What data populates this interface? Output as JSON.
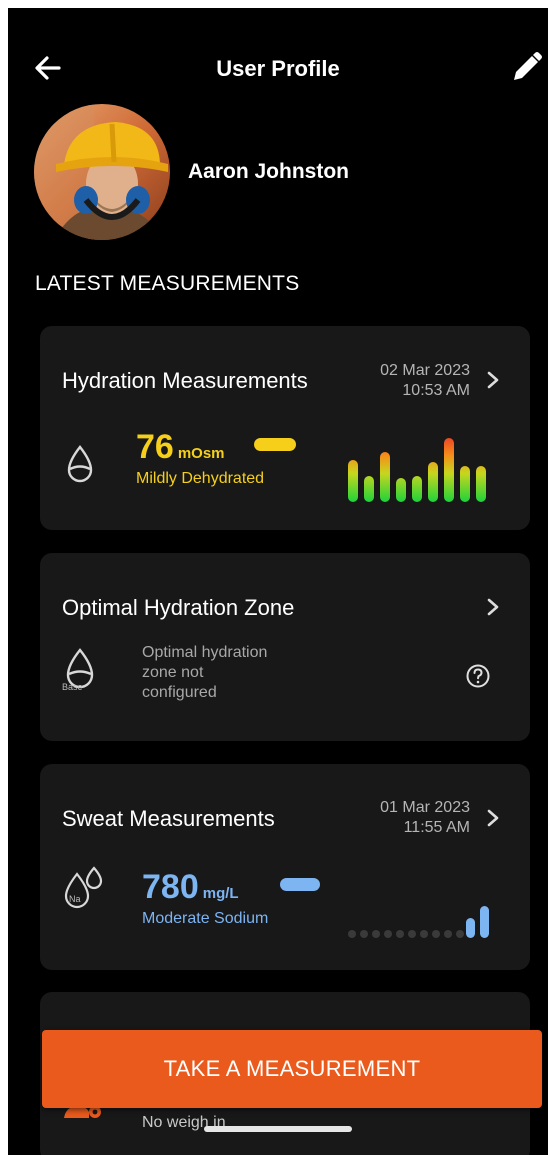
{
  "header": {
    "title": "User Profile",
    "back_icon": "arrow-left-icon",
    "edit_icon": "pencil-icon"
  },
  "profile": {
    "name": "Aaron Johnston"
  },
  "section_title": "LATEST MEASUREMENTS",
  "hydration": {
    "title": "Hydration Measurements",
    "date": "02 Mar 2023",
    "time": "10:53 AM",
    "value": "76",
    "unit": "mOsm",
    "status": "Mildly Dehydrated",
    "accent": "#f5cf1a"
  },
  "zone": {
    "title": "Optimal Hydration Zone",
    "icon_label": "Base",
    "message_line1": "Optimal hydration",
    "message_line2": "zone not",
    "message_line3": "configured"
  },
  "sweat": {
    "title": "Sweat Measurements",
    "date": "01 Mar 2023",
    "time": "11:55 AM",
    "icon_label": "Na",
    "value": "780",
    "unit": "mg/L",
    "status": "Moderate Sodium",
    "accent": "#7db4f2"
  },
  "weight_card": {
    "status": "No weigh in"
  },
  "cta": {
    "label": "TAKE A MEASUREMENT",
    "color": "#ea5a1c"
  }
}
